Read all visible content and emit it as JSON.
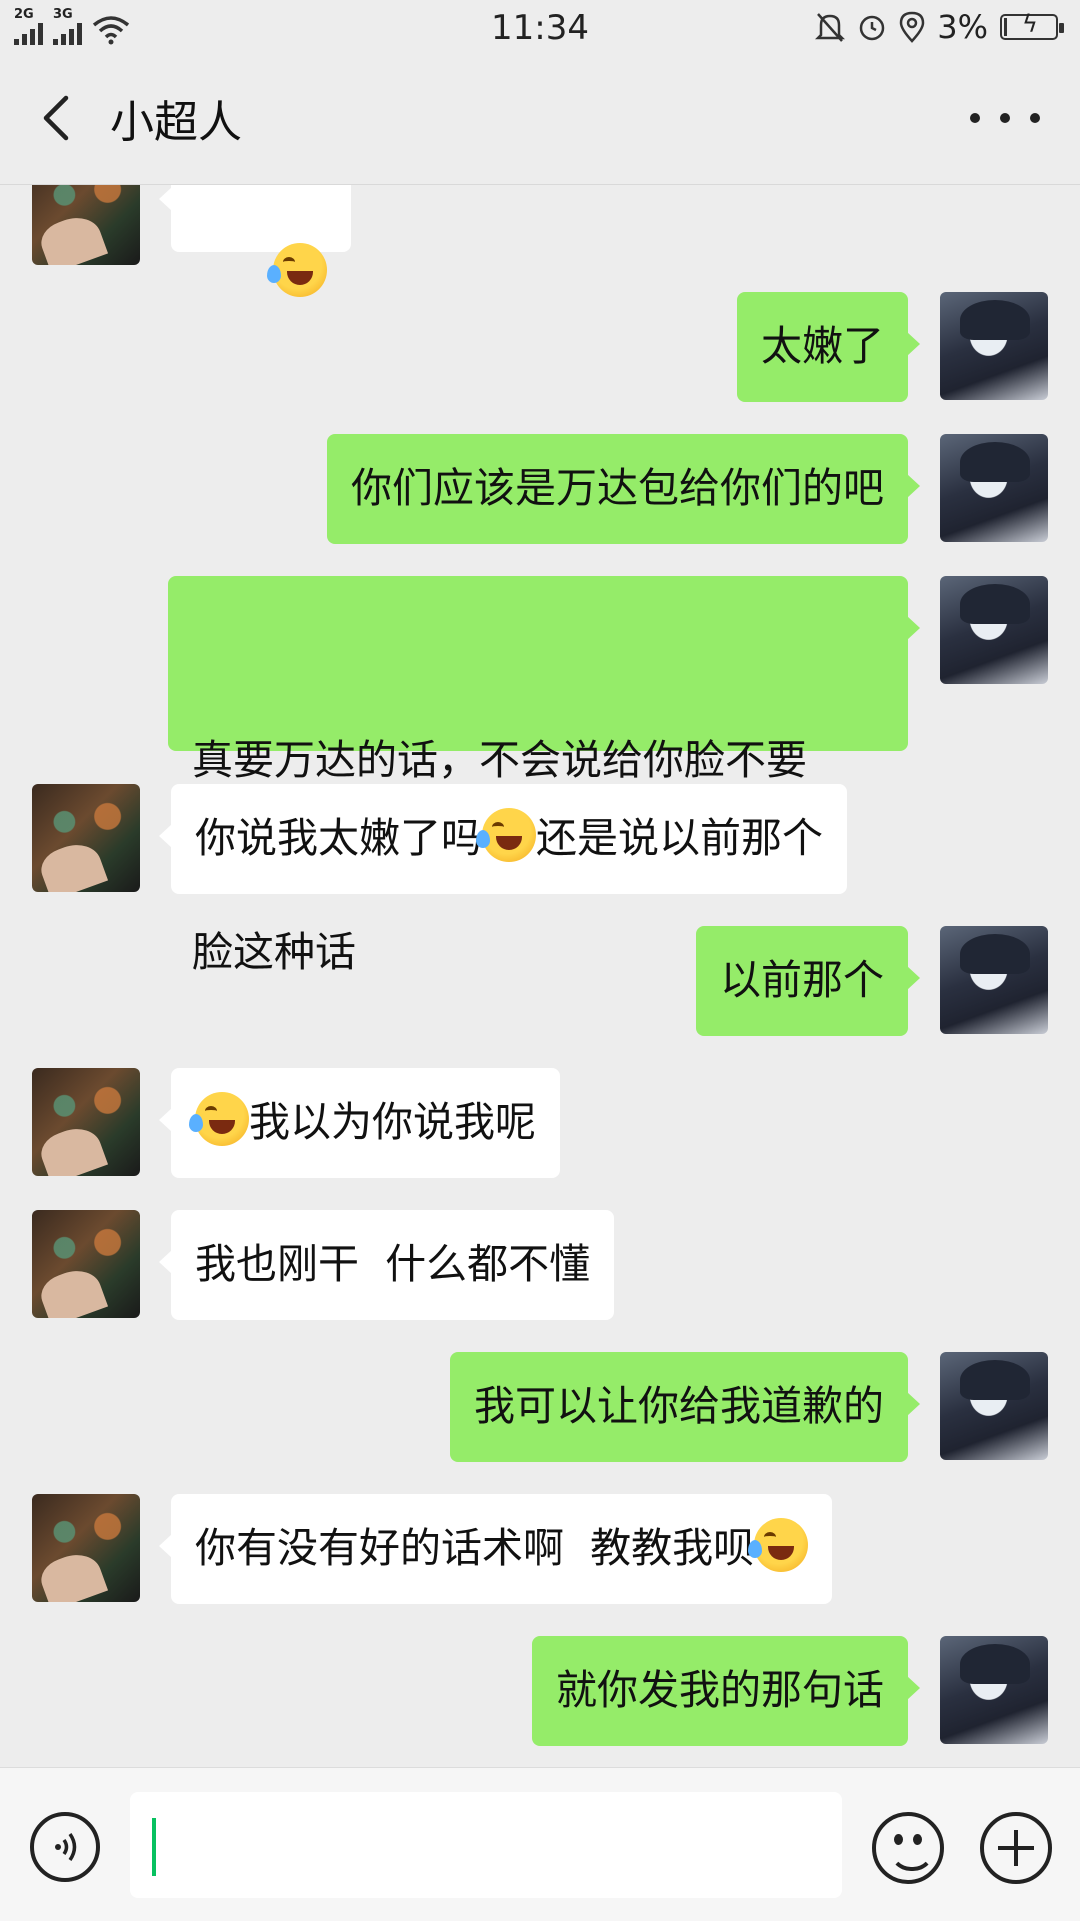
{
  "status_bar": {
    "network_1": "2G",
    "network_2": "3G",
    "time": "11:34",
    "battery_percent": "3%",
    "icons": [
      "signal-icon",
      "wifi-icon",
      "mute-bell-icon",
      "alarm-icon",
      "location-icon",
      "battery-charging-icon"
    ]
  },
  "header": {
    "title": "小超人",
    "back_icon": "chevron-left-icon",
    "more_icon": "more-dots-icon"
  },
  "messages": [
    {
      "from": "friend",
      "parts": [
        {
          "emoji": "face-with-tears-of-joy"
        }
      ]
    },
    {
      "from": "me",
      "text": "太嫩了"
    },
    {
      "from": "me",
      "text": "你们应该是万达包给你们的吧"
    },
    {
      "from": "me",
      "line1": "真要万达的话，不会说给你脸不要",
      "line2": "脸这种话"
    },
    {
      "from": "friend",
      "before": "你说我太嫩了吗",
      "after": "还是说以前那个",
      "emoji": "face-with-tears-of-joy"
    },
    {
      "from": "me",
      "text": "以前那个"
    },
    {
      "from": "friend",
      "after": "我以为你说我呢",
      "emoji": "face-with-tears-of-joy"
    },
    {
      "from": "friend",
      "text": "我也刚干  什么都不懂"
    },
    {
      "from": "me",
      "text": "我可以让你给我道歉的"
    },
    {
      "from": "friend",
      "before": "你有没有好的话术啊  教教我呗",
      "emoji": "face-with-tears-of-joy"
    },
    {
      "from": "me",
      "text": "就你发我的那句话"
    }
  ],
  "input_bar": {
    "value": "",
    "voice_icon": "voice-icon",
    "emoji_icon": "emoji-icon",
    "plus_icon": "plus-icon"
  }
}
